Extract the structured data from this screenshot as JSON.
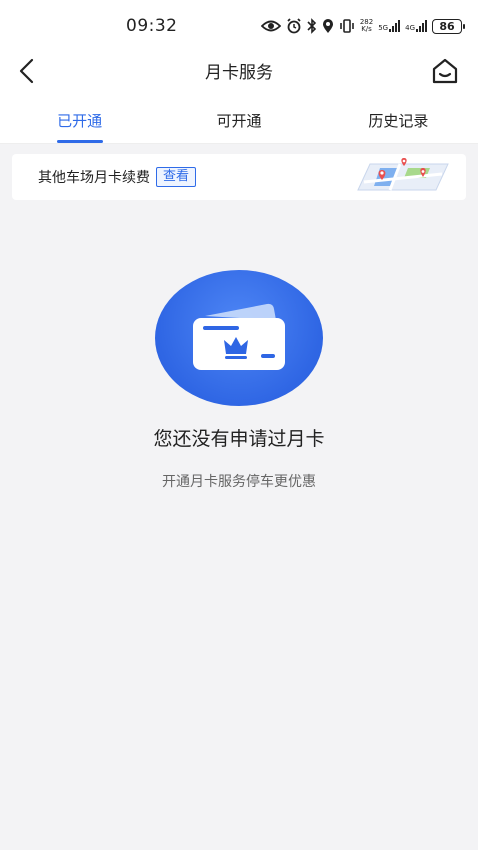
{
  "status_bar": {
    "time": "09:32",
    "net_speed_value": "282",
    "net_speed_unit": "K/s",
    "signal1_label": "5G",
    "signal2_label": "4G",
    "battery": "86"
  },
  "nav": {
    "title": "月卡服务",
    "back_icon": "chevron-left-icon",
    "home_icon": "home-icon"
  },
  "tabs": [
    {
      "label": "已开通",
      "active": true
    },
    {
      "label": "可开通",
      "active": false
    },
    {
      "label": "历史记录",
      "active": false
    }
  ],
  "banner": {
    "text": "其他车场月卡续费",
    "button": "查看",
    "map_icon": "map-icon"
  },
  "empty_state": {
    "icon": "card-crown-icon",
    "title": "您还没有申请过月卡",
    "subtitle": "开通月卡服务停车更优惠"
  },
  "colors": {
    "accent": "#2f6be8",
    "background": "#f3f3f5",
    "card_circle": "#3470e6"
  }
}
